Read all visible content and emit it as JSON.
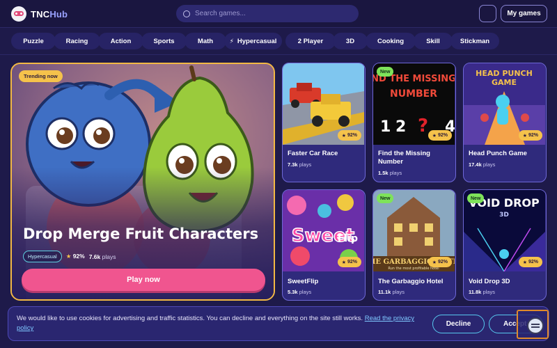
{
  "header": {
    "logo_text_a": "TNC",
    "logo_text_b": "Hub",
    "search_placeholder": "Search games...",
    "my_games_label": "My games"
  },
  "categories": [
    "Puzzle",
    "Racing",
    "Action",
    "Sports",
    "Math",
    "Hypercasual",
    "2 Player",
    "3D",
    "Cooking",
    "Skill",
    "Stickman"
  ],
  "hypercasual_icon": "⚡",
  "hero": {
    "badge": "Trending now",
    "title": "Drop Merge Fruit Characters",
    "tag": "Hypercasual",
    "rating": "92%",
    "plays_count": "7.6k",
    "plays_label": "plays",
    "play_label": "Play now"
  },
  "games": [
    {
      "title": "Faster Car Race",
      "plays": "7.3k",
      "plays_label": "plays",
      "rating": "92%",
      "is_new": false,
      "new_label": ""
    },
    {
      "title": "Find the Missing Number",
      "plays": "1.5k",
      "plays_label": "plays",
      "rating": "92%",
      "is_new": true,
      "new_label": "New",
      "art_title": "ND THE MISSING NUMBER",
      "art_nums": "1 2 ? 4"
    },
    {
      "title": "Head Punch Game",
      "plays": "17.4k",
      "plays_label": "plays",
      "rating": "92%",
      "is_new": false,
      "new_label": "",
      "art_title": "HEAD PUNCH GAME"
    },
    {
      "title": "SweetFlip",
      "plays": "5.3k",
      "plays_label": "plays",
      "rating": "92%",
      "is_new": false,
      "new_label": "",
      "art_title": "Sweet Flip"
    },
    {
      "title": "The Garbaggio Hotel",
      "plays": "11.1k",
      "plays_label": "plays",
      "rating": "92%",
      "is_new": true,
      "new_label": "New",
      "art_title": "THE GARBAGGIO HOTEL",
      "art_sub": "Run the most profitable hotel"
    },
    {
      "title": "Void Drop 3D",
      "plays": "11.8k",
      "plays_label": "plays",
      "rating": "92%",
      "is_new": true,
      "new_label": "New",
      "art_title": "VOID DROP",
      "art_sub": "3D"
    }
  ],
  "cookie": {
    "text": "We would like to use cookies for advertising and traffic statistics. You can decline and everything on the site still works.",
    "link": "Read the privacy policy",
    "decline_label": "Decline",
    "accept_label": "Accept"
  },
  "colors": {
    "background": "#1e1a4a",
    "accent_pink": "#f0558f",
    "badge_yellow": "#f5c24b",
    "new_green": "#7ee35a",
    "card_border": "#6e68d8",
    "cookie_button_border": "#57c9ef"
  },
  "icons": {
    "search": "search-icon",
    "star": "star-icon",
    "bolt": "bolt-icon",
    "chat": "chat-widget-icon"
  }
}
